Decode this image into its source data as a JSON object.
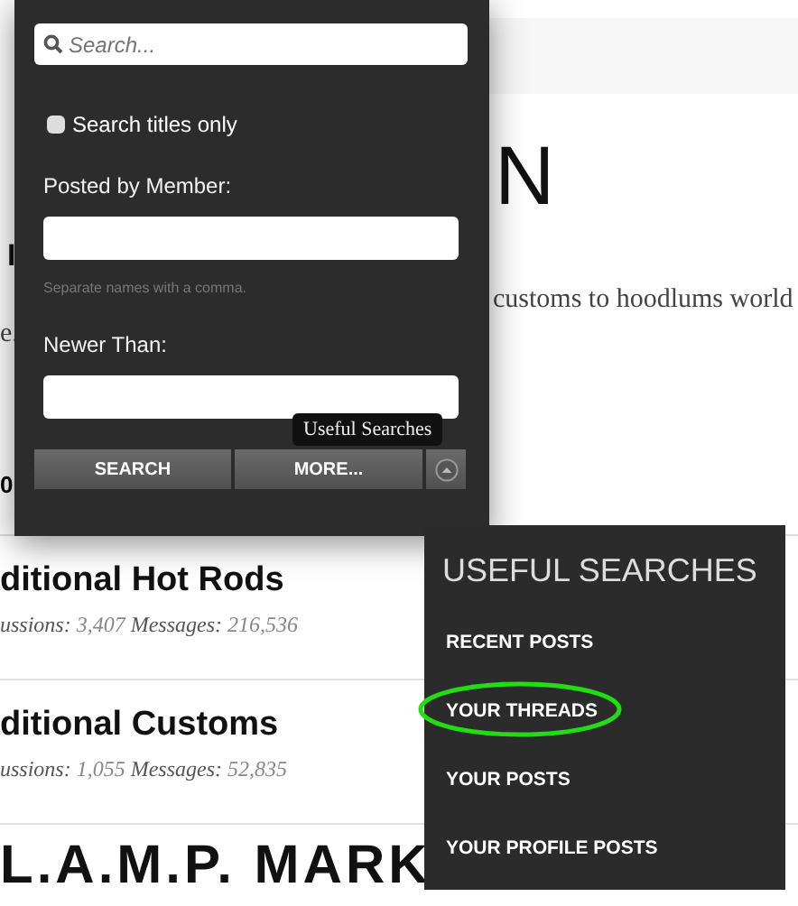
{
  "page": {
    "heading_right": "N",
    "fragment": "I",
    "description_right": "customs to hoodlums world",
    "description_left": "e.",
    "count_fragment": "0"
  },
  "forums": [
    {
      "title": "ditional Hot Rods",
      "discussions_label": "ussions:",
      "discussions": "3,407",
      "messages_label": "Messages:",
      "messages": "216,536"
    },
    {
      "title": "ditional Customs",
      "discussions_label": "ussions:",
      "discussions": "1,055",
      "messages_label": "Messages:",
      "messages": "52,835"
    }
  ],
  "bottom_heading": "L.A.M.P. MARK",
  "search_popup": {
    "search": {
      "placeholder": "Search..."
    },
    "titles_only": {
      "label": "Search titles only",
      "checked": false
    },
    "member": {
      "label": "Posted by Member:",
      "hint": "Separate names with a comma."
    },
    "newer_than": {
      "label": "Newer Than:"
    },
    "buttons": [
      "SEARCH",
      "MORE..."
    ],
    "tooltip": "Useful Searches"
  },
  "useful_searches": {
    "title": "USEFUL SEARCHES",
    "items": [
      {
        "label": "RECENT POSTS",
        "circled": false
      },
      {
        "label": "YOUR THREADS",
        "circled": true
      },
      {
        "label": "YOUR POSTS",
        "circled": false
      },
      {
        "label": "YOUR PROFILE POSTS",
        "circled": false
      }
    ]
  }
}
